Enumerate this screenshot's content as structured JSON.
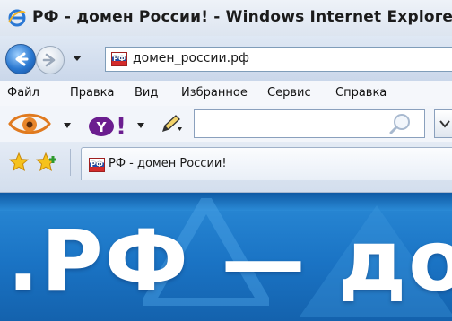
{
  "window": {
    "title": "РФ - домен России! - Windows Internet Explorer",
    "icon": "internet-explorer-icon"
  },
  "navigation": {
    "back_icon": "back-arrow-icon",
    "forward_icon": "forward-arrow-icon",
    "address": {
      "url": "домен_россии.рф",
      "favicon": "РФ"
    }
  },
  "menu": {
    "items": [
      "Файл",
      "Правка",
      "Вид",
      "Избранное",
      "Сервис",
      "Справка"
    ]
  },
  "toolbar": {
    "search_value": "",
    "icons": [
      "eye-icon",
      "yahoo-icon",
      "pencil-icon",
      "magnifier-icon"
    ],
    "yahoo_text": "Y!"
  },
  "tabs": {
    "favorites_icon": "star-icon",
    "add_favorites_icon": "add-favorites-icon",
    "items": [
      {
        "label": "РФ - домен России!",
        "favicon": "РФ"
      }
    ]
  },
  "page": {
    "headline": ".РФ — до",
    "colors": {
      "background": "#1a73c4",
      "text": "#ffffff"
    }
  }
}
